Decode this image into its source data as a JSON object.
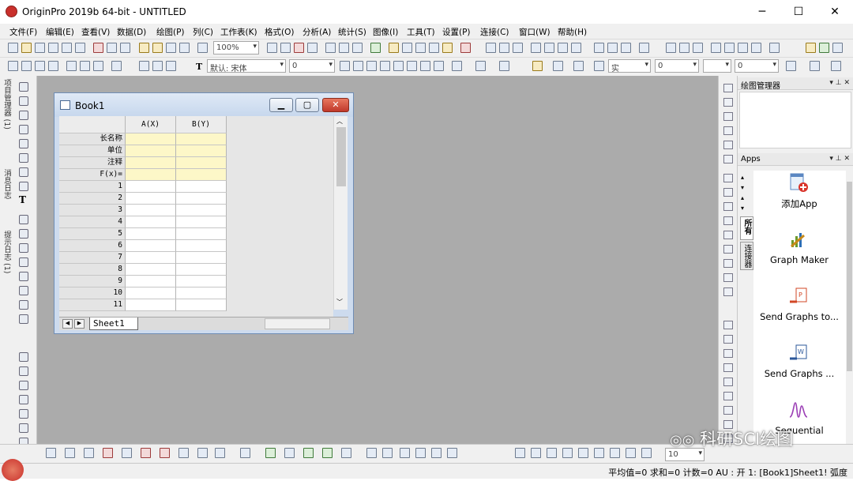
{
  "window": {
    "title": "OriginPro 2019b 64-bit - UNTITLED",
    "controls": [
      "─",
      "☐",
      "✕"
    ]
  },
  "menu": [
    "文件(F)",
    "编辑(E)",
    "查看(V)",
    "数据(D)",
    "绘图(P)",
    "列(C)",
    "工作表(K)",
    "格式(O)",
    "分析(A)",
    "统计(S)",
    "图像(I)",
    "工具(T)",
    "设置(P)",
    "连接(C)",
    "窗口(W)",
    "帮助(H)"
  ],
  "toolbar": {
    "zoom": "100%",
    "font_name": "默认: 宋体",
    "font_size": "0",
    "line_style": "实",
    "line_width": "0",
    "style_value": "0",
    "font_symbol": "T"
  },
  "left_panel": {
    "tabs": [
      "项目管理器 (1)",
      "消息日志",
      "提示日志 (1)"
    ]
  },
  "book": {
    "title": "Book1",
    "columns": [
      "A(X)",
      "B(Y)"
    ],
    "label_rows": [
      "长名称",
      "单位",
      "注释",
      "F(x)="
    ],
    "row_numbers": [
      "1",
      "2",
      "3",
      "4",
      "5",
      "6",
      "7",
      "8",
      "9",
      "10",
      "11"
    ],
    "sheet_tab": "Sheet1"
  },
  "right_panel": {
    "graph_manager": "绘图管理器",
    "apps_header": "Apps",
    "side_tabs": [
      "所有",
      "连接器"
    ],
    "apps": [
      {
        "name": "添加App",
        "icon": "add-app-icon"
      },
      {
        "name": "Graph Maker",
        "icon": "graph-maker-icon"
      },
      {
        "name": "Send Graphs to...",
        "icon": "send-graphs-ppt-icon"
      },
      {
        "name": "Send Graphs ...",
        "icon": "send-graphs-word-icon"
      },
      {
        "name": "Sequential",
        "icon": "sequential-icon"
      }
    ]
  },
  "bottom": {
    "value_field": "10"
  },
  "status": {
    "text": "平均值=0 求和=0 计数=0  AU : 开   1: [Book1]Sheet1!  弧度"
  },
  "watermark": "科研SCI绘图",
  "colors": {
    "workspace": "#ababab",
    "label_rows": "#fdf7c8",
    "close_button": "#c0392b"
  }
}
